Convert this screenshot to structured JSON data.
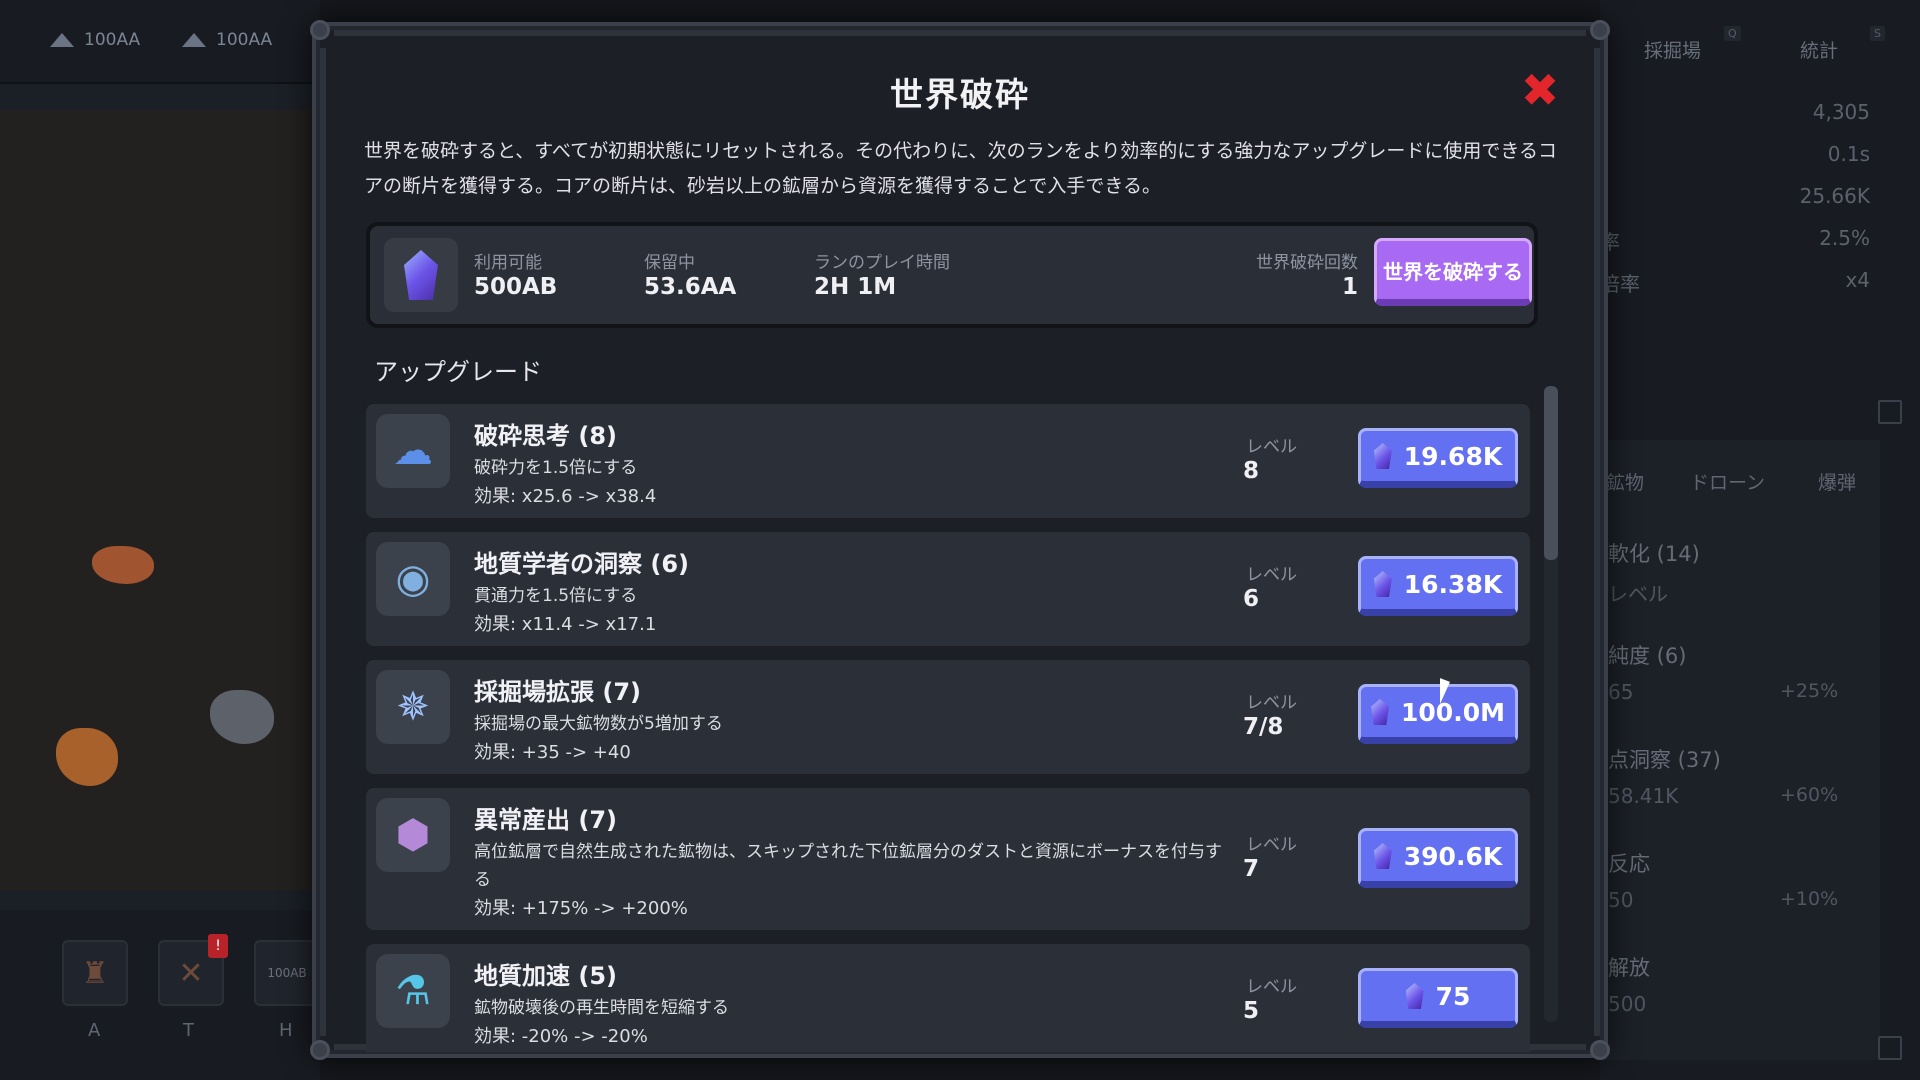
{
  "background": {
    "resources": [
      "100AA",
      "100AA"
    ],
    "right_tabs": [
      {
        "label": "採掘場",
        "key": "Q"
      },
      {
        "label": "統計",
        "key": "S"
      }
    ],
    "stats": [
      {
        "label": "",
        "value": "4,305"
      },
      {
        "label": "",
        "value": "0.1s"
      },
      {
        "label": "",
        "value": "25.66K"
      },
      {
        "label": "率",
        "value": "2.5%"
      },
      {
        "label": "倍率",
        "value": "x4"
      }
    ],
    "panel_tabs": [
      {
        "label": "鉱物",
        "key": "R"
      },
      {
        "label": "ドローン",
        "key": "D"
      },
      {
        "label": "爆弾",
        "key": "B"
      }
    ],
    "panel_items": [
      {
        "name": "軟化 (14)",
        "sub": "レベル",
        "value": ""
      },
      {
        "name": "純度 (6)",
        "sub": "65",
        "value": "+25%"
      },
      {
        "name": "点洞察 (37)",
        "sub": "58.41K",
        "value": "+60%"
      },
      {
        "name": "反応",
        "sub": "50",
        "value": "+10%"
      },
      {
        "name": "解放",
        "sub": "500",
        "value": ""
      }
    ],
    "hotbar": [
      {
        "key": "A",
        "icon": "trophy-icon"
      },
      {
        "key": "T",
        "icon": "tools-icon",
        "badge": "!"
      },
      {
        "key": "H",
        "icon": "drill-icon",
        "label": "100AB"
      }
    ]
  },
  "modal": {
    "title": "世界破砕",
    "description": "世界を破砕すると、すべてが初期状態にリセットされる。その代わりに、次のランをより効率的にする強力なアップグレードに使用できるコアの断片を獲得する。コアの断片は、砂岩以上の鉱層から資源を獲得することで入手できる。",
    "info": {
      "available_label": "利用可能",
      "available_value": "500AB",
      "held_label": "保留中",
      "held_value": "53.6AA",
      "playtime_label": "ランのプレイ時間",
      "playtime_value": "2H 1M",
      "count_label": "世界破砕回数",
      "count_value": "1",
      "shatter_button": "世界を破砕する"
    },
    "upgrades_title": "アップグレード",
    "level_label": "レベル",
    "upgrades": [
      {
        "name": "破砕思考 (8)",
        "desc": "破砕力を1.5倍にする",
        "effect": "効果: x25.6 -> x38.4",
        "level": "8",
        "price": "19.68K",
        "icon": "brain-icon"
      },
      {
        "name": "地質学者の洞察 (6)",
        "desc": "貫通力を1.5倍にする",
        "effect": "効果: x11.4 -> x17.1",
        "level": "6",
        "price": "16.38K",
        "icon": "eye-icon"
      },
      {
        "name": "採掘場拡張 (7)",
        "desc": "採掘場の最大鉱物数が5増加する",
        "effect": "効果: +35 -> +40",
        "level": "7/8",
        "price": "100.0M",
        "icon": "expansion-icon"
      },
      {
        "name": "異常産出 (7)",
        "desc": "高位鉱層で自然生成された鉱物は、スキップされた下位鉱層分のダストと資源にボーナスを付与する",
        "effect": "効果: +175% -> +200%",
        "level": "7",
        "price": "390.6K",
        "icon": "ore-icon"
      },
      {
        "name": "地質加速 (5)",
        "desc": "鉱物破壊後の再生時間を短縮する",
        "effect": "効果: -20% -> -20%",
        "level": "5",
        "price": "75",
        "icon": "potion-icon"
      }
    ]
  }
}
